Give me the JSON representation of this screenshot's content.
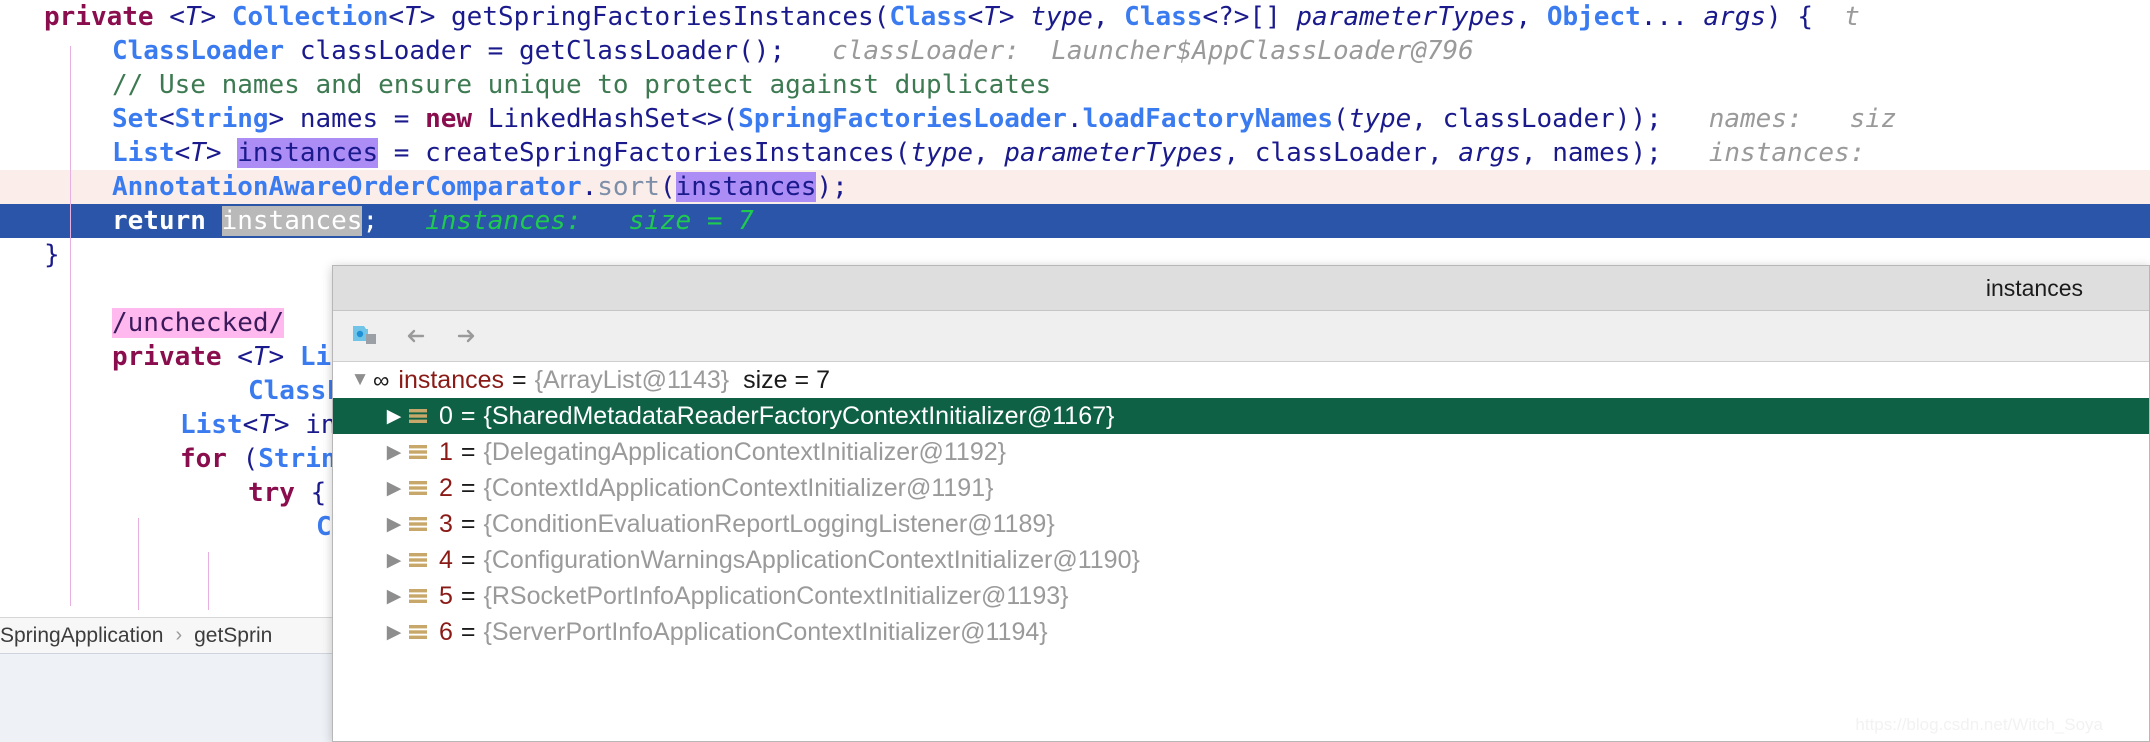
{
  "editor": {
    "lines": [
      {
        "id": "line-signature",
        "indent": 0,
        "tokens": [
          {
            "t": "private",
            "c": "kw"
          },
          {
            "t": " ",
            "c": "plain"
          },
          {
            "t": "<T>",
            "c": "gen"
          },
          {
            "t": " ",
            "c": "plain"
          },
          {
            "t": "Collection",
            "c": "type"
          },
          {
            "t": "<T>",
            "c": "gen"
          },
          {
            "t": " getSpringFactoriesInstances(",
            "c": "plain"
          },
          {
            "t": "Class",
            "c": "type"
          },
          {
            "t": "<T>",
            "c": "gen"
          },
          {
            "t": " ",
            "c": "plain"
          },
          {
            "t": "type",
            "c": "param"
          },
          {
            "t": ", ",
            "c": "plain"
          },
          {
            "t": "Class",
            "c": "type"
          },
          {
            "t": "<?>[] ",
            "c": "plain"
          },
          {
            "t": "parameterTypes",
            "c": "param"
          },
          {
            "t": ", ",
            "c": "plain"
          },
          {
            "t": "Object",
            "c": "type"
          },
          {
            "t": "... ",
            "c": "plain"
          },
          {
            "t": "args",
            "c": "param"
          },
          {
            "t": ") { ",
            "c": "plain"
          },
          {
            "t": " t",
            "c": "hint"
          }
        ]
      },
      {
        "id": "line-classloader",
        "indent": 1,
        "tokens": [
          {
            "t": "ClassLoader",
            "c": "type"
          },
          {
            "t": " classLoader = getClassLoader();",
            "c": "plain"
          },
          {
            "t": "   classLoader:  Launcher$AppClassLoader@796",
            "c": "hint"
          }
        ]
      },
      {
        "id": "line-comment",
        "indent": 1,
        "tokens": [
          {
            "t": "// Use names and ensure unique to protect against duplicates",
            "c": "comment"
          }
        ]
      },
      {
        "id": "line-names",
        "indent": 1,
        "tokens": [
          {
            "t": "Set",
            "c": "type"
          },
          {
            "t": "<",
            "c": "plain"
          },
          {
            "t": "String",
            "c": "type"
          },
          {
            "t": "> names = ",
            "c": "plain"
          },
          {
            "t": "new",
            "c": "kw"
          },
          {
            "t": " LinkedHashSet<>(",
            "c": "plain"
          },
          {
            "t": "SpringFactoriesLoader",
            "c": "type"
          },
          {
            "t": ".",
            "c": "plain"
          },
          {
            "t": "loadFactoryNames",
            "c": "type"
          },
          {
            "t": "(",
            "c": "plain"
          },
          {
            "t": "type",
            "c": "param"
          },
          {
            "t": ", classLoader));",
            "c": "plain"
          },
          {
            "t": "   names:   siz",
            "c": "hint"
          }
        ]
      },
      {
        "id": "line-instances",
        "indent": 1,
        "tokens": [
          {
            "t": "List",
            "c": "type"
          },
          {
            "t": "<T>",
            "c": "gen"
          },
          {
            "t": " ",
            "c": "plain"
          },
          {
            "t": "instances",
            "c": "hl-var"
          },
          {
            "t": " = createSpringFactoriesInstances(",
            "c": "plain"
          },
          {
            "t": "type",
            "c": "param"
          },
          {
            "t": ", ",
            "c": "plain"
          },
          {
            "t": "parameterTypes",
            "c": "param"
          },
          {
            "t": ", classLoader, ",
            "c": "plain"
          },
          {
            "t": "args",
            "c": "param"
          },
          {
            "t": ", names);",
            "c": "plain"
          },
          {
            "t": "   instances:",
            "c": "hint"
          }
        ]
      },
      {
        "id": "line-sort",
        "indent": 1,
        "row": "row-sort",
        "tokens": [
          {
            "t": "AnnotationAwareOrderComparator",
            "c": "type"
          },
          {
            "t": ".",
            "c": "plain"
          },
          {
            "t": "sort",
            "c": "method"
          },
          {
            "t": "(",
            "c": "plain"
          },
          {
            "t": "instances",
            "c": "hl-var"
          },
          {
            "t": ");",
            "c": "plain"
          }
        ]
      },
      {
        "id": "line-return",
        "indent": 1,
        "row": "row-return",
        "tokens": [
          {
            "t": "return ",
            "c": "kw"
          },
          {
            "t": "instances",
            "c": "hl-sel"
          },
          {
            "t": ";",
            "c": "plain"
          },
          {
            "t": "   instances:   size = 7",
            "c": "hint-green"
          }
        ]
      },
      {
        "id": "line-close-brace",
        "indent": 0,
        "tokens": [
          {
            "t": "}",
            "c": "plain"
          }
        ]
      },
      {
        "id": "line-blank-1",
        "indent": 0,
        "tokens": [
          {
            "t": " ",
            "c": "plain"
          }
        ]
      },
      {
        "id": "line-unchecked",
        "indent": 1,
        "tokens": [
          {
            "t": "/unchecked/",
            "c": "hl-pink"
          }
        ]
      },
      {
        "id": "line-private-list",
        "indent": 1,
        "tokens": [
          {
            "t": "private",
            "c": "kw"
          },
          {
            "t": " ",
            "c": "plain"
          },
          {
            "t": "<T>",
            "c": "gen"
          },
          {
            "t": " ",
            "c": "plain"
          },
          {
            "t": "Lis",
            "c": "type"
          }
        ]
      },
      {
        "id": "line-classloader-2",
        "indent": 3,
        "tokens": [
          {
            "t": "ClassLo",
            "c": "type"
          }
        ]
      },
      {
        "id": "line-list-ins",
        "indent": 2,
        "tokens": [
          {
            "t": "List",
            "c": "type"
          },
          {
            "t": "<T>",
            "c": "gen"
          },
          {
            "t": " ins",
            "c": "plain"
          }
        ]
      },
      {
        "id": "line-for",
        "indent": 2,
        "tokens": [
          {
            "t": "for",
            "c": "kw"
          },
          {
            "t": " (",
            "c": "plain"
          },
          {
            "t": "String",
            "c": "type"
          }
        ]
      },
      {
        "id": "line-try",
        "indent": 3,
        "tokens": [
          {
            "t": "try",
            "c": "kw"
          },
          {
            "t": " {",
            "c": "plain"
          }
        ]
      },
      {
        "id": "line-cla",
        "indent": 4,
        "tokens": [
          {
            "t": "Cla",
            "c": "type"
          }
        ]
      }
    ]
  },
  "breadcrumb": {
    "items": [
      "SpringApplication",
      "getSprin"
    ],
    "separator": "›"
  },
  "popup": {
    "title": "instances",
    "toolbar": {
      "object_icon": "object-folder-icon",
      "back_icon": "arrow-left-icon",
      "forward_icon": "arrow-right-icon"
    },
    "tree": {
      "root": {
        "expander": "▼",
        "marker": "∞",
        "name": "instances",
        "eq": "=",
        "value": "{ArrayList@1143}",
        "size": "size = 7"
      },
      "children": [
        {
          "expander": "▶",
          "index": "0",
          "eq": "=",
          "value": "{SharedMetadataReaderFactoryContextInitializer@1167}",
          "selected": true
        },
        {
          "expander": "▶",
          "index": "1",
          "eq": "=",
          "value": "{DelegatingApplicationContextInitializer@1192}",
          "selected": false
        },
        {
          "expander": "▶",
          "index": "2",
          "eq": "=",
          "value": "{ContextIdApplicationContextInitializer@1191}",
          "selected": false
        },
        {
          "expander": "▶",
          "index": "3",
          "eq": "=",
          "value": "{ConditionEvaluationReportLoggingListener@1189}",
          "selected": false
        },
        {
          "expander": "▶",
          "index": "4",
          "eq": "=",
          "value": "{ConfigurationWarningsApplicationContextInitializer@1190}",
          "selected": false
        },
        {
          "expander": "▶",
          "index": "5",
          "eq": "=",
          "value": "{RSocketPortInfoApplicationContextInitializer@1193}",
          "selected": false
        },
        {
          "expander": "▶",
          "index": "6",
          "eq": "=",
          "value": "{ServerPortInfoApplicationContextInitializer@1194}",
          "selected": false
        }
      ]
    }
  },
  "watermark": "https://blog.csdn.net/Witch_Soya",
  "colors": {
    "selection_blue": "#2b55a8",
    "selected_row_green": "#0e6145",
    "keyword": "#8a0d4e",
    "type_blue": "#3b7bf0",
    "comment_green": "#3d7a52",
    "hint_gray": "#9a9a9a",
    "hint_green": "#1ecb4f",
    "var_highlight": "#ac8cf5",
    "pink_highlight": "#ffb9ee",
    "sort_row_pink": "#fbeeea",
    "value_gray": "#9a9a9a",
    "name_red": "#8a1a16"
  }
}
